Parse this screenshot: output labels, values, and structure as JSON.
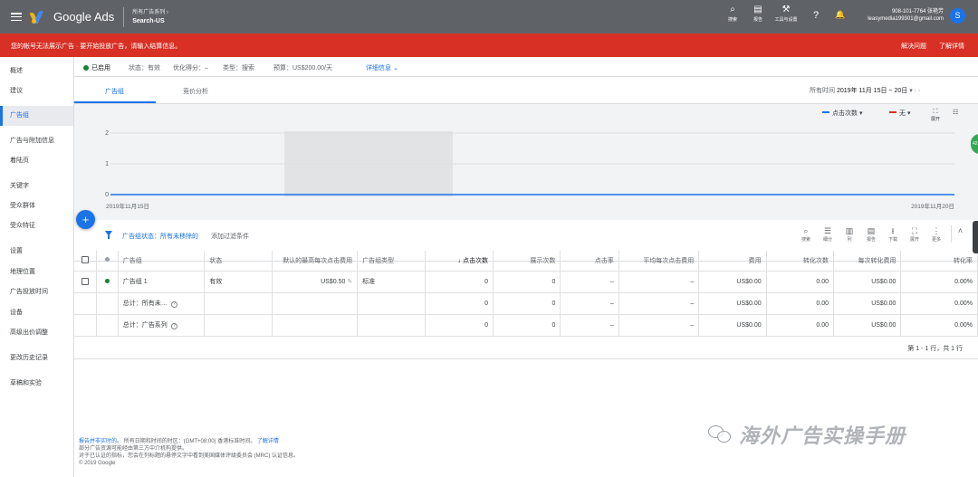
{
  "topbar": {
    "brand": "Google Ads",
    "breadcrumb_top": "所有广告系列 ›",
    "breadcrumb_main": "Search-US",
    "actions": [
      {
        "icon": "search-icon",
        "glyph": "⌕",
        "label": "搜索"
      },
      {
        "icon": "reports-icon",
        "glyph": "▤",
        "label": "报告"
      },
      {
        "icon": "tools-icon",
        "glyph": "⚒",
        "label": "工具与设置"
      }
    ],
    "help_glyph": "?",
    "bell_glyph": "🔔",
    "account_phone": "908-101-7764 张艳芳",
    "account_email": "leasymedia199301@gmail.com",
    "avatar_letter": "S"
  },
  "alert": {
    "text": "您的帐号无法展示广告 · 要开始投放广告，请输入结算信息。",
    "fix": "解决问题",
    "details": "了解详情"
  },
  "sidebar": {
    "items": [
      {
        "label": "概述"
      },
      {
        "label": "建议"
      },
      {
        "label": "广告组"
      },
      {
        "label": "广告与附加信息"
      },
      {
        "label": "着陆页"
      },
      {
        "label": "关键字"
      },
      {
        "label": "受众群体"
      },
      {
        "label": "受众特征"
      },
      {
        "label": "设置"
      },
      {
        "label": "地理位置"
      },
      {
        "label": "广告投放时间"
      },
      {
        "label": "设备"
      },
      {
        "label": "高级出价调整"
      },
      {
        "label": "更改历史记录"
      },
      {
        "label": "草稿和实验"
      }
    ]
  },
  "status": {
    "enabled": "已启用",
    "state": "状态：有效",
    "optimization": "优化得分：–",
    "type": "类型：搜索",
    "budget": "预算：US$200.00/天",
    "details": "详细信息"
  },
  "tabs": {
    "adgroups": "广告组",
    "auction": "竞价分析",
    "date_label": "所有时间",
    "date_value": "2019年 11月 15日 ~ 20日"
  },
  "chart_data": {
    "type": "line",
    "x": [
      "2019年11月15日",
      "2019年11月20日"
    ],
    "series": [
      {
        "name": "点击次数",
        "values": [
          0,
          0
        ]
      }
    ],
    "yticks": [
      0,
      1,
      2
    ],
    "ylim": [
      0,
      2
    ],
    "legend": [
      "点击次数",
      "无"
    ],
    "legend_colors": [
      "#1a73e8",
      "#d93025"
    ],
    "expand_label": "展开",
    "badge": "42"
  },
  "filter": {
    "prefix": "广告组状态：",
    "value": "所有未移除的",
    "add": "添加过滤条件"
  },
  "tools": [
    {
      "icon": "search-icon",
      "glyph": "⌕",
      "label": "搜索"
    },
    {
      "icon": "segment-icon",
      "glyph": "☰",
      "label": "细分"
    },
    {
      "icon": "columns-icon",
      "glyph": "▥",
      "label": "列"
    },
    {
      "icon": "reports-icon",
      "glyph": "▤",
      "label": "报告"
    },
    {
      "icon": "download-icon",
      "glyph": "⭳",
      "label": "下载"
    },
    {
      "icon": "expand-icon",
      "glyph": "⛶",
      "label": "展开"
    },
    {
      "icon": "more-icon",
      "glyph": "⋮",
      "label": "更多"
    }
  ],
  "table": {
    "headers": [
      "广告组",
      "状态",
      "默认的最高每次点击费用",
      "广告组类型",
      "↓ 点击次数",
      "展示次数",
      "点击率",
      "平均每次点击费用",
      "费用",
      "转化次数",
      "每次转化费用",
      "转化率"
    ],
    "rows": [
      {
        "name": "广告组 1",
        "status": "有效",
        "max_cpc": "US$0.50",
        "type": "标准",
        "clicks": "0",
        "impr": "0",
        "ctr": "–",
        "avg_cpc": "–",
        "cost": "US$0.00",
        "conv": "0.00",
        "cost_conv": "US$0.00",
        "conv_rate": "0.00%"
      }
    ],
    "totals": [
      {
        "name": "总计：所有未…",
        "clicks": "0",
        "impr": "0",
        "ctr": "–",
        "avg_cpc": "–",
        "cost": "US$0.00",
        "conv": "0.00",
        "cost_conv": "US$0.00",
        "conv_rate": "0.00%"
      },
      {
        "name": "总计：广告系列",
        "clicks": "0",
        "impr": "0",
        "ctr": "–",
        "avg_cpc": "–",
        "cost": "US$0.00",
        "conv": "0.00",
        "cost_conv": "US$0.00",
        "conv_rate": "0.00%"
      }
    ],
    "pager": "第 1 - 1 行，共 1 行"
  },
  "footer": {
    "line1_link": "报告并非实时的。",
    "line1_text": "所有日期和时间的时区：(GMT+08:00) 香港标准时间。",
    "line1_more": "了解详情",
    "line2": "部分广告资源可能经由第三方中介机构提供。",
    "line3": "对于已认证的指标，您会在列标题的悬停文字中看到美国媒体评级委员会 (MRC) 认证信息。",
    "copyright": "© 2019 Google"
  },
  "watermark": "海外广告实操手册"
}
